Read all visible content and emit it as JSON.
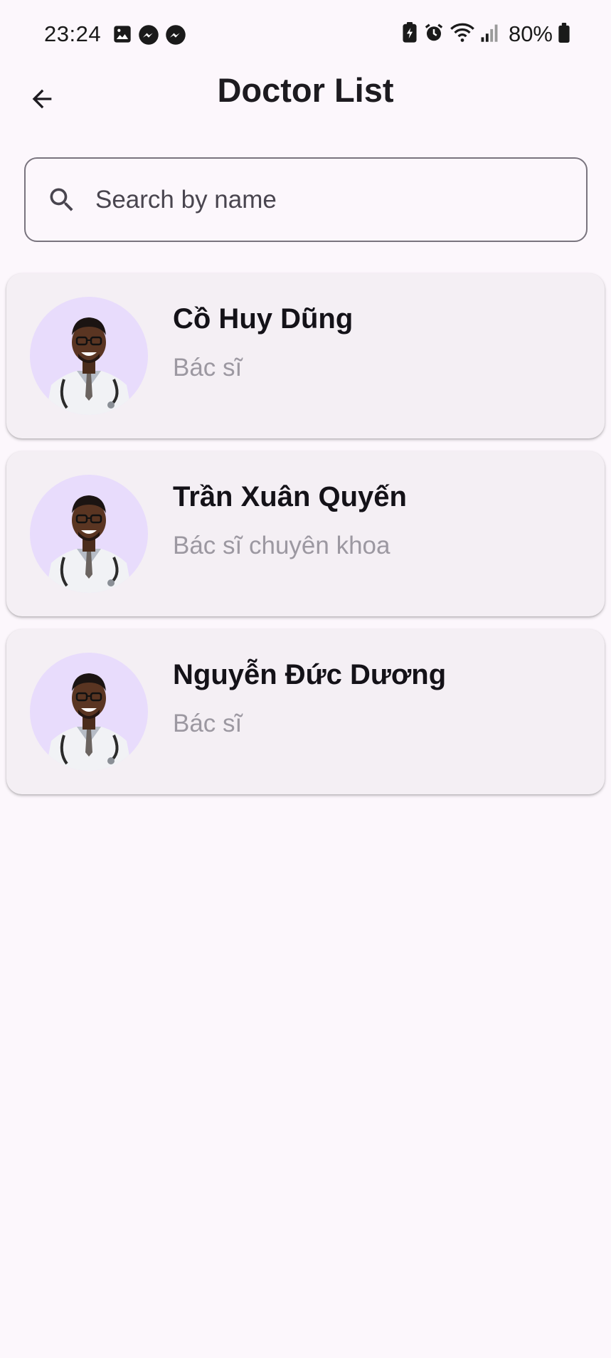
{
  "status_bar": {
    "time": "23:24",
    "notification_icons": [
      "gallery-icon",
      "messenger-icon",
      "messenger-icon"
    ],
    "system_icons": [
      "battery-saver-icon",
      "alarm-icon",
      "wifi-icon",
      "signal-icon"
    ],
    "battery_percent": "80%"
  },
  "app_bar": {
    "back_icon": "arrow-back-icon",
    "title": "Doctor List"
  },
  "search": {
    "placeholder": "Search by name",
    "value": ""
  },
  "doctors": [
    {
      "name": "Cồ Huy Dũng",
      "title": "Bác sĩ"
    },
    {
      "name": "Trần Xuân Quyến",
      "title": "Bác sĩ chuyên khoa"
    },
    {
      "name": "Nguyễn Đức Dương",
      "title": "Bác sĩ"
    }
  ],
  "colors": {
    "background": "#fcf7fc",
    "card": "#f4eff4",
    "avatar_bg": "#e8dcfc",
    "title_text": "#1d1b20",
    "subtitle_text": "#9c98a1",
    "outline": "#79747e"
  }
}
